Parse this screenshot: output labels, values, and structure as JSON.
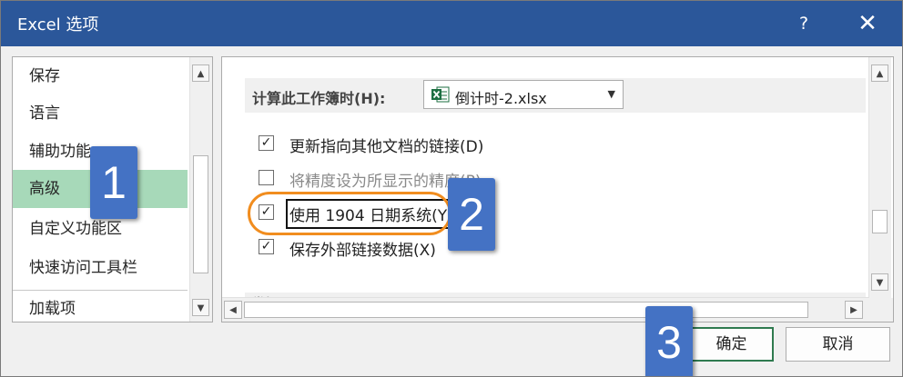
{
  "window": {
    "title": "Excel 选项",
    "help_label": "?",
    "close_label": "✕"
  },
  "nav": {
    "items": [
      {
        "label": "保存"
      },
      {
        "label": "语言"
      },
      {
        "label": "辅助功能"
      },
      {
        "label": "高级",
        "selected": true
      },
      {
        "label": "自定义功能区"
      },
      {
        "label": "快速访问工具栏"
      },
      {
        "label": "加载项"
      }
    ]
  },
  "content": {
    "section_label": "计算此工作簿时(H):",
    "workbook_select": {
      "value": "倒计时-2.xlsx",
      "icon": "excel-file-icon"
    },
    "options": [
      {
        "label": "更新指向其他文档的链接(D)",
        "checked": true,
        "enabled": true
      },
      {
        "label": "将精度设为所显示的精度(P)",
        "checked": false,
        "enabled": false
      },
      {
        "label": "使用 1904 日期系统(Y)",
        "checked": true,
        "enabled": true,
        "focused": true
      },
      {
        "label": "保存外部链接数据(X)",
        "checked": true,
        "enabled": true
      }
    ],
    "next_section_label": "常规"
  },
  "buttons": {
    "ok_label": "确定",
    "cancel_label": "取消"
  },
  "callouts": [
    {
      "label": "1"
    },
    {
      "label": "2"
    },
    {
      "label": "3"
    }
  ],
  "colors": {
    "title_bar": "#2b579a",
    "nav_selected": "#a7d9b9",
    "callout": "#4472c4",
    "highlight_ring": "#f18d1f",
    "ok_border": "#2f7a4f"
  }
}
